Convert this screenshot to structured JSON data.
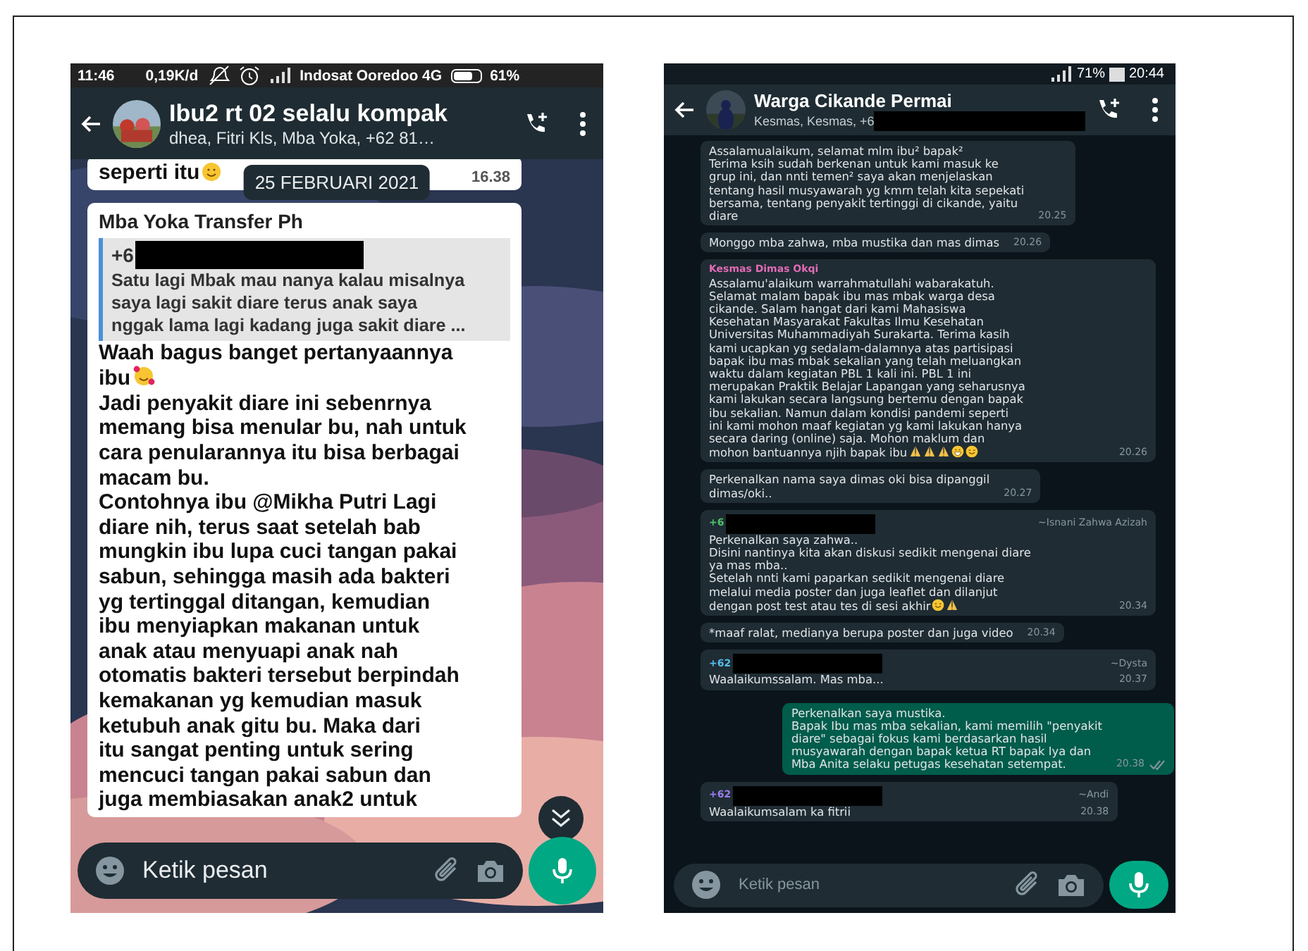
{
  "phones": [
    {
      "kind": "light",
      "status_bar": [
        {
          "kind": "text",
          "text": "11:46"
        },
        {
          "kind": "text",
          "text": "0,19K/d"
        },
        {
          "kind": "mute"
        },
        {
          "kind": "alarm"
        },
        {
          "kind": "signal"
        },
        {
          "kind": "text",
          "text": "Indosat Ooredoo 4G"
        },
        {
          "kind": "battery"
        },
        {
          "kind": "text",
          "text": "61%"
        }
      ],
      "header": {
        "title": "Ibu2 rt 02 selalu kompak",
        "subtitle": "dhea, Fitri Kls, Mba Yoka, +62 81…"
      },
      "date_chip": "25 FEBRUARI 2021",
      "messages": [
        {
          "outgoing": false,
          "parts": [
            {
              "text": "seperti itu",
              "emoji": [
                {
                  "kind": "hug"
                }
              ]
            }
          ],
          "time": "16.38"
        },
        {
          "outgoing": false,
          "sender": "Mba Yoka Transfer Ph",
          "quote": {
            "sender": "+6",
            "redacted": true,
            "text": "Satu lagi Mbak mau nanya kalau misalnya\nsaya lagi sakit diare terus anak saya\nnggak lama lagi kadang juga sakit diare ..."
          },
          "parts": [
            {
              "text": "Waah bagus banget pertanyaannya"
            },
            {
              "text": "ibu",
              "emoji": [
                {
                  "kind": "hearts"
                }
              ]
            },
            {
              "text": "Jadi penyakit diare ini sebenrnya\nmemang bisa menular bu, nah untuk\ncara penularannya itu bisa berbagai\nmacam bu.\nContohnya ibu @Mikha Putri Lagi\ndiare nih, terus saat setelah bab\nmungkin ibu lupa cuci tangan pakai\nsabun, sehingga masih ada bakteri\nyg tertinggal ditangan, kemudian\nibu menyiapkan makanan untuk\nanak atau menyuapi anak nah\notomatis bakteri tersebut berpindah\nkemakanan yg kemudian masuk\nketubuh anak gitu bu. Maka dari\nitu sangat penting untuk sering\nmencuci tangan pakai sabun dan\njuga membiasakan anak2 untuk"
            }
          ]
        }
      ],
      "scroll_button": true,
      "composer": {
        "placeholder": "Ketik pesan"
      }
    },
    {
      "kind": "dark",
      "status_bar": [
        {
          "kind": "signal"
        },
        {
          "kind": "text",
          "text": "71%"
        },
        {
          "kind": "battery"
        },
        {
          "kind": "text",
          "text": "20:44"
        }
      ],
      "header": {
        "title": "Warga Cikande Permai",
        "subtitle": "Kesmas, Kesmas, +6",
        "redacted": true
      },
      "messages": [
        {
          "outgoing": false,
          "parts": [
            {
              "text": "Assalamualaikum, selamat mlm ibu² bapak²\nTerima ksih sudah berkenan untuk kami masuk ke\ngrup ini, dan nnti temen² saya akan menjelaskan\ntentang hasil musyawarah yg kmrn telah kita sepekati\nbersama, tentang penyakit tertinggi di cikande, yaitu\ndiare"
            }
          ],
          "time": "20.25"
        },
        {
          "outgoing": false,
          "parts": [
            {
              "text": "Monggo mba zahwa, mba mustika dan mas dimas"
            }
          ],
          "time": "20.26"
        },
        {
          "outgoing": false,
          "sender": "Kesmas Dimas Okqi",
          "color": "#e26ab6",
          "parts": [
            {
              "text": "Assalamu'alaikum warrahmatullahi wabarakatuh.\nSelamat malam bapak ibu mas mbak warga desa\ncikande. Salam hangat dari kami Mahasiswa\nKesehatan Masyarakat Fakultas Ilmu Kesehatan\nUniversitas Muhammadiyah Surakarta. Terima kasih\nkami ucapkan yg sedalam-dalamnya atas partisipasi\nbapak ibu mas mbak sekalian yang telah meluangkan\nwaktu dalam kegiatan PBL 1 kali ini. PBL 1 ini\nmerupakan Praktik Belajar Lapangan yang seharusnya\nkami lakukan secara langsung bertemu dengan bapak\nibu sekalian. Namun dalam kondisi pandemi seperti\nini kami mohon maaf kegiatan yg kami lakukan hanya\nsecara daring (online) saja. Mohon maklum dan"
            },
            {
              "text": "mohon bantuannya njih bapak ibu",
              "emoji": [
                {
                  "kind": "pray"
                },
                {
                  "kind": "pray"
                },
                {
                  "kind": "pray"
                },
                {
                  "kind": "grin"
                },
                {
                  "kind": "smile"
                }
              ]
            }
          ],
          "time": "20.26"
        },
        {
          "outgoing": false,
          "parts": [
            {
              "text": "Perkenalkan nama saya dimas oki bisa dipanggil\ndimas/oki.."
            }
          ],
          "time": "20.27"
        },
        {
          "outgoing": false,
          "sender": "+6",
          "redacted": true,
          "color": "#4fc36a",
          "alias": "~Isnani Zahwa Azizah",
          "parts": [
            {
              "text": "Perkenalkan saya zahwa..\nDisini nantinya kita akan diskusi sedikit mengenai diare\nya mas mba..\nSetelah nnti kami paparkan sedikit mengenai diare\nmelalui media poster dan juga leaflet dan dilanjut"
            },
            {
              "text": "dengan post test atau tes di sesi akhir",
              "emoji": [
                {
                  "kind": "smile"
                },
                {
                  "kind": "pray"
                }
              ]
            }
          ],
          "time": "20.34"
        },
        {
          "outgoing": false,
          "parts": [
            {
              "text": "*maaf ralat, medianya berupa poster dan juga video"
            }
          ],
          "time": "20.34"
        },
        {
          "outgoing": false,
          "sender": "+62",
          "redacted": true,
          "color": "#53bdeb",
          "alias": "~Dysta",
          "parts": [
            {
              "text": "Waalaikumssalam. Mas mba..."
            }
          ],
          "time": "20.37"
        },
        {
          "outgoing": true,
          "parts": [
            {
              "text": "Perkenalkan saya mustika.\nBapak Ibu mas mba sekalian, kami memilih \"penyakit\ndiare\" sebagai fokus kami berdasarkan hasil\nmusyawarah dengan bapak ketua RT bapak Iya dan\nMba Anita selaku petugas kesehatan setempat."
            }
          ],
          "time": "20.38",
          "read": false
        },
        {
          "outgoing": false,
          "sender": "+62",
          "redacted": true,
          "color": "#9b7cf0",
          "alias": "~Andi",
          "parts": [
            {
              "text": "Waalaikumsalam ka fitrii"
            }
          ],
          "time": "20.38"
        }
      ],
      "composer": {
        "placeholder": "Ketik pesan"
      }
    }
  ]
}
